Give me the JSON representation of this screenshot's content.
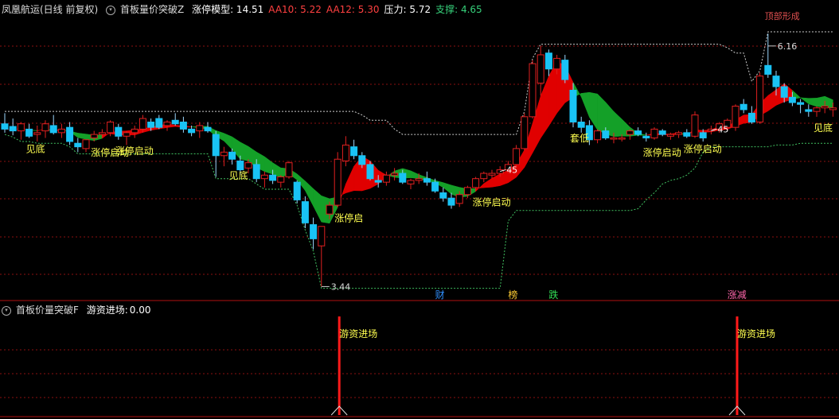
{
  "header": {
    "stock": "凤凰航运(日线 前复权)",
    "indicator": "首板量价突破Z",
    "values": [
      {
        "label": "涨停模型:",
        "value": "14.51",
        "color": "#ffffff"
      },
      {
        "label": "AA10:",
        "value": "5.22",
        "color": "#ff4040"
      },
      {
        "label": "AA12:",
        "value": "5.30",
        "color": "#ff4040"
      },
      {
        "label": "压力:",
        "value": "5.72",
        "color": "#ffffff"
      },
      {
        "label": "支撑:",
        "value": "4.65",
        "color": "#36d07a"
      }
    ]
  },
  "sub_header": {
    "indicator": "首板价量突破F",
    "label": "游资进场:",
    "value": "0.00"
  },
  "colors": {
    "up": "#e02020",
    "down": "#19c3f5",
    "band_up": "#e00000",
    "band_down": "#14a028",
    "signal_text": "#ffff50",
    "grid": "#8b1010",
    "border": "#b01010",
    "dotted": "#cccccc",
    "dotted_green": "#40c060",
    "bar": "#ff1a1a"
  },
  "chart_data": [
    {
      "type": "candlestick",
      "title": "",
      "xlabel": "",
      "ylabel": "",
      "ylim": [
        3.3,
        6.5
      ],
      "grid": true,
      "annotations": {
        "high": {
          "label": "6.16",
          "value": 6.16
        },
        "low": {
          "label": "3.44",
          "value": 3.44
        },
        "partial_top": "顶部形成",
        "price_tags": [
          "45",
          "45"
        ]
      },
      "signals": [
        {
          "text": "见底"
        },
        {
          "text": "涨停启动"
        },
        {
          "text": "涨停启动"
        },
        {
          "text": "见底"
        },
        {
          "text": "涨停启"
        },
        {
          "text": "涨停启动"
        },
        {
          "text": "套低"
        },
        {
          "text": "涨停启动"
        },
        {
          "text": "涨停启动"
        },
        {
          "text": "见底"
        }
      ],
      "event_tags": [
        {
          "text": "财",
          "color": "#3090ff"
        },
        {
          "text": "榜",
          "color": "#ffcc33"
        },
        {
          "text": "跌",
          "color": "#33dd55"
        },
        {
          "text": "涨减",
          "color": "#ff66aa"
        }
      ],
      "candles": [
        {
          "o": 5.28,
          "h": 5.4,
          "l": 5.18,
          "c": 5.22
        },
        {
          "o": 5.25,
          "h": 5.34,
          "l": 5.15,
          "c": 5.2
        },
        {
          "o": 5.2,
          "h": 5.3,
          "l": 5.1,
          "c": 5.28
        },
        {
          "o": 5.22,
          "h": 5.28,
          "l": 5.12,
          "c": 5.14
        },
        {
          "o": 5.16,
          "h": 5.26,
          "l": 5.08,
          "c": 5.18
        },
        {
          "o": 5.2,
          "h": 5.32,
          "l": 5.12,
          "c": 5.28
        },
        {
          "o": 5.26,
          "h": 5.38,
          "l": 5.16,
          "c": 5.18
        },
        {
          "o": 5.18,
          "h": 5.28,
          "l": 5.12,
          "c": 5.22
        },
        {
          "o": 5.24,
          "h": 5.3,
          "l": 5.04,
          "c": 5.08
        },
        {
          "o": 5.06,
          "h": 5.12,
          "l": 4.96,
          "c": 5.02
        },
        {
          "o": 5.0,
          "h": 5.1,
          "l": 4.96,
          "c": 5.1
        },
        {
          "o": 5.12,
          "h": 5.2,
          "l": 5.08,
          "c": 5.16
        },
        {
          "o": 5.16,
          "h": 5.22,
          "l": 5.12,
          "c": 5.18
        },
        {
          "o": 5.18,
          "h": 5.32,
          "l": 5.14,
          "c": 5.3
        },
        {
          "o": 5.24,
          "h": 5.28,
          "l": 5.1,
          "c": 5.14
        },
        {
          "o": 5.14,
          "h": 5.2,
          "l": 5.04,
          "c": 5.18
        },
        {
          "o": 5.18,
          "h": 5.26,
          "l": 5.12,
          "c": 5.22
        },
        {
          "o": 5.22,
          "h": 5.38,
          "l": 5.18,
          "c": 5.34
        },
        {
          "o": 5.3,
          "h": 5.34,
          "l": 5.2,
          "c": 5.24
        },
        {
          "o": 5.34,
          "h": 5.38,
          "l": 5.22,
          "c": 5.24
        },
        {
          "o": 5.26,
          "h": 5.32,
          "l": 5.2,
          "c": 5.3
        },
        {
          "o": 5.32,
          "h": 5.4,
          "l": 5.26,
          "c": 5.28
        },
        {
          "o": 5.3,
          "h": 5.36,
          "l": 5.18,
          "c": 5.22
        },
        {
          "o": 5.22,
          "h": 5.26,
          "l": 5.14,
          "c": 5.18
        },
        {
          "o": 5.2,
          "h": 5.3,
          "l": 5.12,
          "c": 5.26
        },
        {
          "o": 5.24,
          "h": 5.3,
          "l": 5.18,
          "c": 5.2
        },
        {
          "o": 5.16,
          "h": 5.2,
          "l": 4.68,
          "c": 4.92
        },
        {
          "o": 4.92,
          "h": 5.02,
          "l": 4.8,
          "c": 4.96
        },
        {
          "o": 4.96,
          "h": 5.0,
          "l": 4.82,
          "c": 4.88
        },
        {
          "o": 4.86,
          "h": 4.92,
          "l": 4.7,
          "c": 4.76
        },
        {
          "o": 4.78,
          "h": 4.88,
          "l": 4.72,
          "c": 4.84
        },
        {
          "o": 4.82,
          "h": 4.88,
          "l": 4.62,
          "c": 4.66
        },
        {
          "o": 4.66,
          "h": 4.74,
          "l": 4.56,
          "c": 4.7
        },
        {
          "o": 4.7,
          "h": 4.76,
          "l": 4.6,
          "c": 4.64
        },
        {
          "o": 4.62,
          "h": 4.7,
          "l": 4.56,
          "c": 4.68
        },
        {
          "o": 4.68,
          "h": 4.86,
          "l": 4.66,
          "c": 4.84
        },
        {
          "o": 4.62,
          "h": 4.64,
          "l": 4.38,
          "c": 4.42
        },
        {
          "o": 4.4,
          "h": 4.46,
          "l": 4.1,
          "c": 4.16
        },
        {
          "o": 4.14,
          "h": 4.22,
          "l": 3.86,
          "c": 3.98
        },
        {
          "o": 3.9,
          "h": 4.12,
          "l": 3.44,
          "c": 4.12
        },
        {
          "o": 4.26,
          "h": 4.4,
          "l": 4.2,
          "c": 4.36
        },
        {
          "o": 4.36,
          "h": 4.96,
          "l": 4.34,
          "c": 4.88
        },
        {
          "o": 4.86,
          "h": 5.14,
          "l": 4.8,
          "c": 5.04
        },
        {
          "o": 5.02,
          "h": 5.1,
          "l": 4.88,
          "c": 4.92
        },
        {
          "o": 4.92,
          "h": 4.96,
          "l": 4.78,
          "c": 4.82
        },
        {
          "o": 4.82,
          "h": 4.86,
          "l": 4.64,
          "c": 4.66
        },
        {
          "o": 4.64,
          "h": 4.7,
          "l": 4.56,
          "c": 4.62
        },
        {
          "o": 4.62,
          "h": 4.74,
          "l": 4.58,
          "c": 4.7
        },
        {
          "o": 4.7,
          "h": 4.78,
          "l": 4.64,
          "c": 4.72
        },
        {
          "o": 4.72,
          "h": 4.76,
          "l": 4.6,
          "c": 4.62
        },
        {
          "o": 4.6,
          "h": 4.66,
          "l": 4.54,
          "c": 4.64
        },
        {
          "o": 4.64,
          "h": 4.72,
          "l": 4.6,
          "c": 4.66
        },
        {
          "o": 4.66,
          "h": 4.74,
          "l": 4.58,
          "c": 4.62
        },
        {
          "o": 4.62,
          "h": 4.66,
          "l": 4.5,
          "c": 4.52
        },
        {
          "o": 4.5,
          "h": 4.56,
          "l": 4.4,
          "c": 4.44
        },
        {
          "o": 4.44,
          "h": 4.5,
          "l": 4.32,
          "c": 4.36
        },
        {
          "o": 4.38,
          "h": 4.52,
          "l": 4.34,
          "c": 4.48
        },
        {
          "o": 4.48,
          "h": 4.58,
          "l": 4.44,
          "c": 4.56
        },
        {
          "o": 4.56,
          "h": 4.68,
          "l": 4.52,
          "c": 4.66
        },
        {
          "o": 4.66,
          "h": 4.74,
          "l": 4.62,
          "c": 4.72
        },
        {
          "o": 4.7,
          "h": 4.76,
          "l": 4.66,
          "c": 4.72
        },
        {
          "o": 4.72,
          "h": 4.8,
          "l": 4.68,
          "c": 4.76
        },
        {
          "o": 4.76,
          "h": 4.86,
          "l": 4.72,
          "c": 4.82
        },
        {
          "o": 4.82,
          "h": 5.04,
          "l": 4.8,
          "c": 5.0
        },
        {
          "o": 5.0,
          "h": 5.4,
          "l": 4.98,
          "c": 5.36
        },
        {
          "o": 5.36,
          "h": 6.0,
          "l": 5.34,
          "c": 5.96
        },
        {
          "o": 5.74,
          "h": 6.16,
          "l": 5.6,
          "c": 6.06
        },
        {
          "o": 6.08,
          "h": 6.12,
          "l": 5.82,
          "c": 5.9
        },
        {
          "o": 5.9,
          "h": 6.06,
          "l": 5.84,
          "c": 6.02
        },
        {
          "o": 6.0,
          "h": 6.06,
          "l": 5.74,
          "c": 5.78
        },
        {
          "o": 5.66,
          "h": 5.74,
          "l": 5.24,
          "c": 5.3
        },
        {
          "o": 5.3,
          "h": 5.36,
          "l": 5.18,
          "c": 5.24
        },
        {
          "o": 5.26,
          "h": 5.32,
          "l": 5.04,
          "c": 5.1
        },
        {
          "o": 5.1,
          "h": 5.22,
          "l": 5.06,
          "c": 5.2
        },
        {
          "o": 5.2,
          "h": 5.24,
          "l": 5.1,
          "c": 5.12
        },
        {
          "o": 5.12,
          "h": 5.18,
          "l": 5.06,
          "c": 5.12
        },
        {
          "o": 5.12,
          "h": 5.16,
          "l": 5.08,
          "c": 5.12
        },
        {
          "o": 5.16,
          "h": 5.22,
          "l": 5.1,
          "c": 5.2
        },
        {
          "o": 5.2,
          "h": 5.24,
          "l": 5.14,
          "c": 5.16
        },
        {
          "o": 5.14,
          "h": 5.18,
          "l": 5.08,
          "c": 5.12
        },
        {
          "o": 5.12,
          "h": 5.24,
          "l": 5.1,
          "c": 5.22
        },
        {
          "o": 5.2,
          "h": 5.22,
          "l": 5.14,
          "c": 5.16
        },
        {
          "o": 5.14,
          "h": 5.18,
          "l": 5.1,
          "c": 5.16
        },
        {
          "o": 5.16,
          "h": 5.2,
          "l": 5.12,
          "c": 5.18
        },
        {
          "o": 5.18,
          "h": 5.22,
          "l": 5.12,
          "c": 5.14
        },
        {
          "o": 5.14,
          "h": 5.42,
          "l": 5.12,
          "c": 5.38
        },
        {
          "o": 5.18,
          "h": 5.22,
          "l": 5.08,
          "c": 5.12
        },
        {
          "o": 5.2,
          "h": 5.26,
          "l": 5.16,
          "c": 5.22
        },
        {
          "o": 5.22,
          "h": 5.3,
          "l": 5.18,
          "c": 5.28
        },
        {
          "o": 5.24,
          "h": 5.34,
          "l": 5.2,
          "c": 5.32
        },
        {
          "o": 5.24,
          "h": 5.5,
          "l": 5.2,
          "c": 5.48
        },
        {
          "o": 5.5,
          "h": 5.56,
          "l": 5.4,
          "c": 5.44
        },
        {
          "o": 5.4,
          "h": 5.48,
          "l": 5.28,
          "c": 5.3
        },
        {
          "o": 5.3,
          "h": 5.86,
          "l": 5.28,
          "c": 5.82
        },
        {
          "o": 5.94,
          "h": 6.3,
          "l": 5.8,
          "c": 5.84
        },
        {
          "o": 5.82,
          "h": 5.88,
          "l": 5.6,
          "c": 5.7
        },
        {
          "o": 5.7,
          "h": 5.74,
          "l": 5.52,
          "c": 5.58
        },
        {
          "o": 5.58,
          "h": 5.64,
          "l": 5.48,
          "c": 5.52
        },
        {
          "o": 5.52,
          "h": 5.56,
          "l": 5.4,
          "c": 5.5
        },
        {
          "o": 5.44,
          "h": 5.5,
          "l": 5.36,
          "c": 5.42
        },
        {
          "o": 5.42,
          "h": 5.48,
          "l": 5.36,
          "c": 5.46
        },
        {
          "o": 5.46,
          "h": 5.54,
          "l": 5.4,
          "c": 5.48
        },
        {
          "o": 5.44,
          "h": 5.52,
          "l": 5.36,
          "c": 5.46
        }
      ]
    },
    {
      "type": "bar",
      "title": "",
      "series": [
        {
          "name": "游资进场",
          "label_text": "游资进场"
        }
      ],
      "signal_bars": [
        {
          "label": "游资进场",
          "candle_index": 41
        },
        {
          "label": "游资进场",
          "candle_index": 90
        }
      ]
    }
  ]
}
